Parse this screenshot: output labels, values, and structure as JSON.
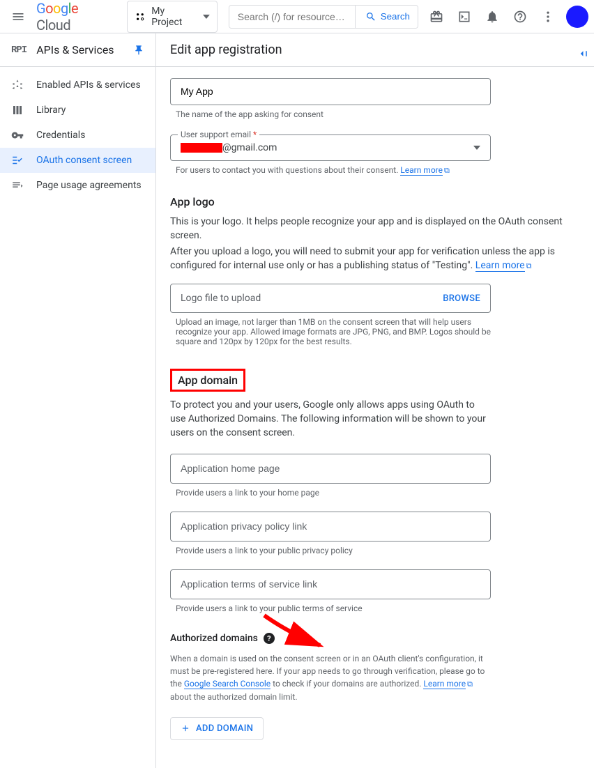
{
  "header": {
    "project_name": "My Project",
    "search_placeholder": "Search (/) for resource…",
    "search_button": "Search"
  },
  "sidebar": {
    "title": "APIs & Services",
    "items": [
      {
        "label": "Enabled APIs & services"
      },
      {
        "label": "Library"
      },
      {
        "label": "Credentials"
      },
      {
        "label": "OAuth consent screen"
      },
      {
        "label": "Page usage agreements"
      }
    ]
  },
  "main": {
    "title": "Edit app registration",
    "app_name_value": "My App",
    "app_name_help": "The name of the app asking for consent",
    "user_email_label": "User support email",
    "user_email_suffix": "@gmail.com",
    "user_email_help": "For users to contact you with questions about their consent.",
    "learn_more": "Learn more",
    "app_logo": {
      "heading": "App logo",
      "desc1": "This is your logo. It helps people recognize your app and is displayed on the OAuth consent screen.",
      "desc2_a": "After you upload a logo, you will need to submit your app for verification unless the app is configured for internal use only or has a publishing status of \"Testing\". ",
      "upload_label": "Logo file to upload",
      "browse": "BROWSE",
      "upload_help": "Upload an image, not larger than 1MB on the consent screen that will help users recognize your app. Allowed image formats are JPG, PNG, and BMP. Logos should be square and 120px by 120px for the best results."
    },
    "app_domain": {
      "heading": "App domain",
      "desc": "To protect you and your users, Google only allows apps using OAuth to use Authorized Domains. The following information will be shown to your users on the consent screen.",
      "home_placeholder": "Application home page",
      "home_help": "Provide users a link to your home page",
      "privacy_placeholder": "Application privacy policy link",
      "privacy_help": "Provide users a link to your public privacy policy",
      "tos_placeholder": "Application terms of service link",
      "tos_help": "Provide users a link to your public terms of service"
    },
    "auth_domains": {
      "heading": "Authorized domains",
      "text_a": "When a domain is used on the consent screen or in an OAuth client's configuration, it must be pre-registered here. If your app needs to go through verification, please go to the ",
      "gsc_link": "Google Search Console",
      "text_b": " to check if your domains are authorized. ",
      "text_c": " about the authorized domain limit.",
      "add_btn": "ADD DOMAIN"
    }
  }
}
